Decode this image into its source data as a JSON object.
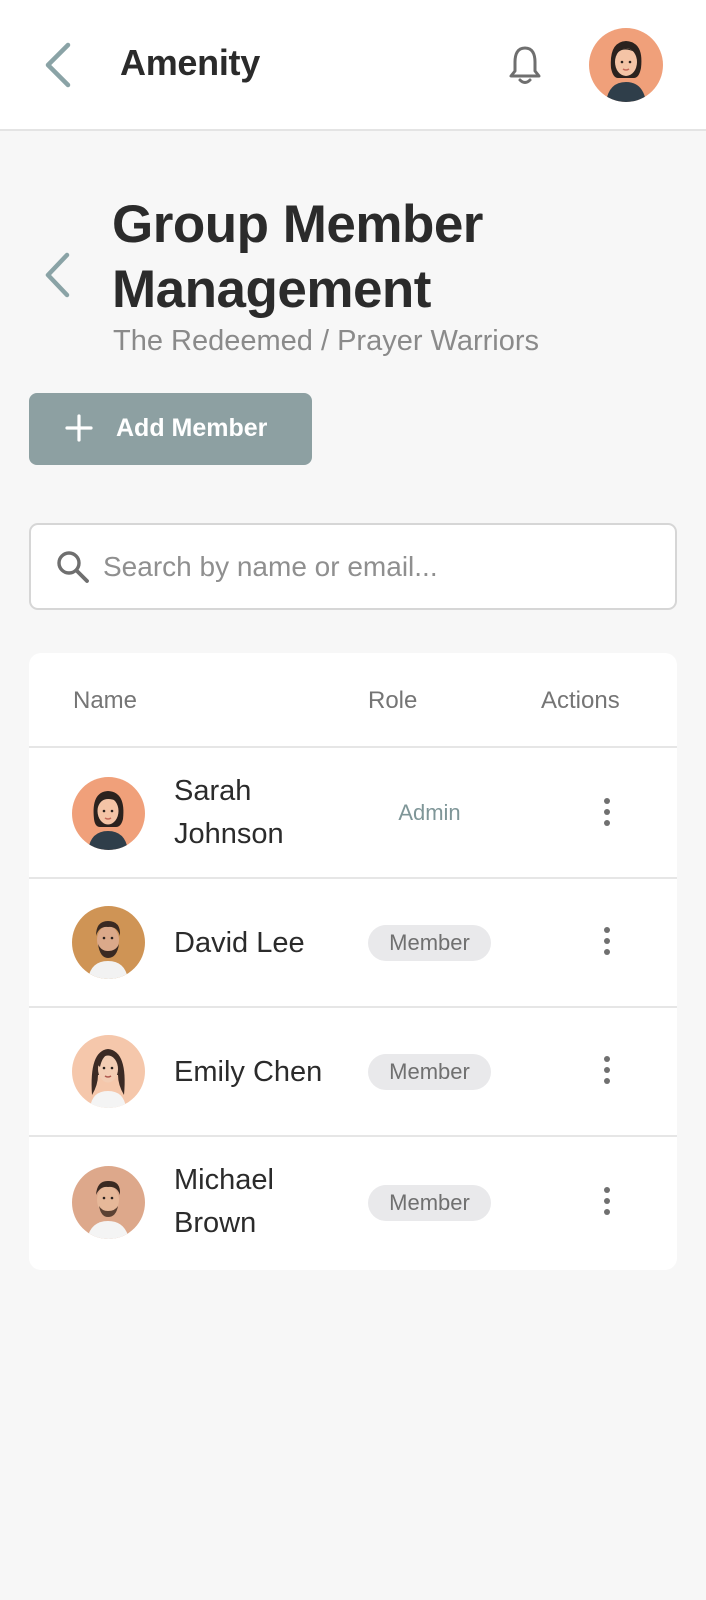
{
  "header": {
    "app_title": "Amenity",
    "icons": [
      "back-chevron-icon",
      "bell-icon",
      "user-avatar"
    ]
  },
  "page": {
    "title": "Group Member Management",
    "breadcrumb": "The Redeemed / Prayer Warriors",
    "add_button_label": "Add Member"
  },
  "search": {
    "placeholder": "Search by name or email...",
    "value": ""
  },
  "table": {
    "columns": [
      "Name",
      "Role",
      "Actions"
    ],
    "rows": [
      {
        "name": "Sarah Johnson",
        "role": "Admin",
        "avatar": "woman-dark-hair-avatar"
      },
      {
        "name": "David Lee",
        "role": "Member",
        "avatar": "man-beard-avatar"
      },
      {
        "name": "Emily Chen",
        "role": "Member",
        "avatar": "woman-long-hair-avatar"
      },
      {
        "name": "Michael Brown",
        "role": "Member",
        "avatar": "man-short-hair-avatar"
      }
    ]
  },
  "colors": {
    "accent": "#8da0a2",
    "background": "#f7f7f7",
    "admin_text": "#7f9698",
    "badge_bg": "#e9e9eb"
  }
}
